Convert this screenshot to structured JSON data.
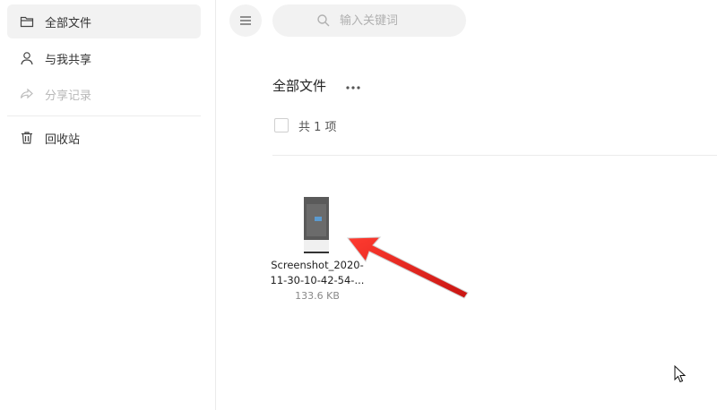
{
  "sidebar": {
    "items": [
      {
        "label": "全部文件",
        "icon": "folder-icon",
        "active": true
      },
      {
        "label": "与我共享",
        "icon": "user-icon"
      },
      {
        "label": "分享记录",
        "icon": "share-icon",
        "disabled": true
      },
      {
        "label": "回收站",
        "icon": "trash-icon"
      }
    ]
  },
  "search": {
    "placeholder": "输入关键词",
    "icon": "search-icon"
  },
  "menu": {
    "icon": "hamburger-icon"
  },
  "main": {
    "title": "全部文件",
    "more_icon": "more-icon",
    "count": "共 1 项",
    "files": [
      {
        "name_line1": "Screenshot_2020-",
        "name_line2": "11-30-10-42-54-...",
        "size": "133.6 KB"
      }
    ]
  },
  "colors": {
    "annotation_arrow": "#e8211d",
    "active_bg": "#f2f2f2"
  }
}
